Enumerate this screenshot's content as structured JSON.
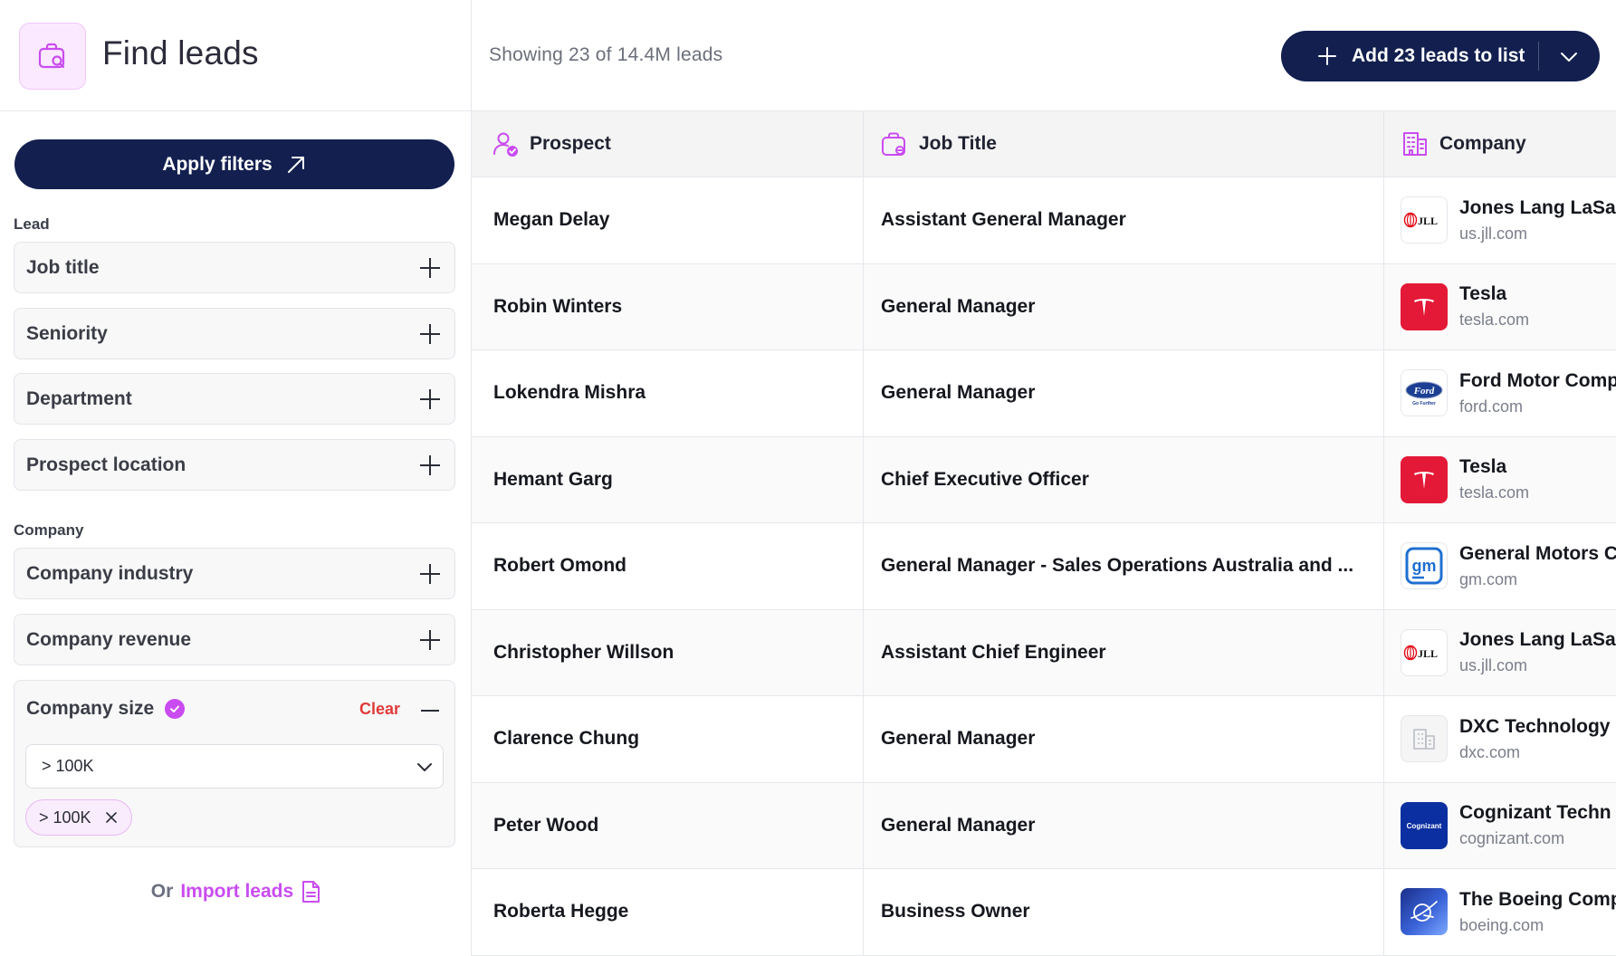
{
  "sidebar": {
    "title": "Find leads",
    "apply_label": "Apply filters",
    "lead_group_label": "Lead",
    "lead_filters": [
      {
        "label": "Job title"
      },
      {
        "label": "Seniority"
      },
      {
        "label": "Department"
      },
      {
        "label": "Prospect location"
      }
    ],
    "company_group_label": "Company",
    "company_filters": [
      {
        "label": "Company industry"
      },
      {
        "label": "Company revenue"
      }
    ],
    "company_size": {
      "label": "Company size",
      "clear_label": "Clear",
      "selected_value": "> 100K",
      "chip_label": "> 100K"
    },
    "import": {
      "prefix": "Or",
      "link_label": "Import leads"
    }
  },
  "header": {
    "showing_text": "Showing 23 of 14.4M leads",
    "add_button_label": "Add 23 leads to list"
  },
  "table": {
    "columns": [
      {
        "label": "Prospect",
        "icon": "user-check-icon"
      },
      {
        "label": "Job Title",
        "icon": "briefcase-icon"
      },
      {
        "label": "Company",
        "icon": "building-icon"
      }
    ],
    "rows": [
      {
        "prospect": "Megan Delay",
        "job_title": "Assistant General Manager",
        "company": "Jones Lang LaSa",
        "domain": "us.jll.com",
        "logo": "jll"
      },
      {
        "prospect": "Robin Winters",
        "job_title": "General Manager",
        "company": "Tesla",
        "domain": "tesla.com",
        "logo": "tesla"
      },
      {
        "prospect": "Lokendra Mishra",
        "job_title": "General Manager",
        "company": "Ford Motor Comp",
        "domain": "ford.com",
        "logo": "ford"
      },
      {
        "prospect": "Hemant Garg",
        "job_title": "Chief Executive Officer",
        "company": "Tesla",
        "domain": "tesla.com",
        "logo": "tesla"
      },
      {
        "prospect": "Robert Omond",
        "job_title": "General Manager - Sales Operations Australia and ...",
        "company": "General Motors C",
        "domain": "gm.com",
        "logo": "gm"
      },
      {
        "prospect": "Christopher Willson",
        "job_title": "Assistant Chief Engineer",
        "company": "Jones Lang LaSa",
        "domain": "us.jll.com",
        "logo": "jll"
      },
      {
        "prospect": "Clarence Chung",
        "job_title": "General Manager",
        "company": "DXC Technology",
        "domain": "dxc.com",
        "logo": "placeholder"
      },
      {
        "prospect": "Peter Wood",
        "job_title": "General Manager",
        "company": "Cognizant Techn",
        "domain": "cognizant.com",
        "logo": "cognizant"
      },
      {
        "prospect": "Roberta Hegge",
        "job_title": "Business Owner",
        "company": "The Boeing Comp",
        "domain": "boeing.com",
        "logo": "boeing"
      }
    ]
  },
  "logo_text": {
    "jll": "JLL",
    "ford": "Ford",
    "ford_tagline": "Go Further",
    "gm": "gm",
    "cognizant": "Cognizant"
  },
  "colors": {
    "navy": "#121f4f",
    "accent": "#c94cf0",
    "danger": "#e03a3a"
  }
}
